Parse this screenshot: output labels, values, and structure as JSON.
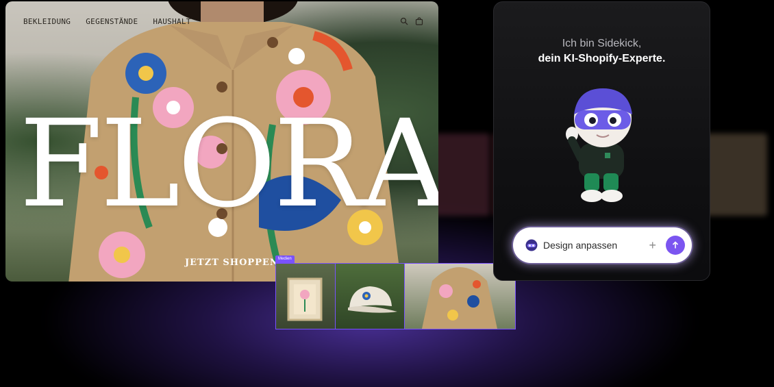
{
  "store": {
    "nav": [
      "BEKLEIDUNG",
      "GEGENSTÄNDE",
      "HAUSHALT"
    ],
    "hero_title": "FLORA",
    "cta_label": "JETZT SHOPPEN",
    "icons": [
      "search-icon",
      "bag-icon"
    ]
  },
  "media": {
    "tag_label": "Medien",
    "thumbs": [
      "framed-art-thumbnail",
      "cap-thumbnail",
      "jacket-thumbnail"
    ]
  },
  "sidekick": {
    "line1": "Ich bin Sidekick,",
    "line2": "dein KI-Shopify-Experte.",
    "prompt_text": "Design anpassen",
    "plus_icon": "plus-icon",
    "send_icon": "arrow-up-icon",
    "accent": "#7b55f0"
  }
}
